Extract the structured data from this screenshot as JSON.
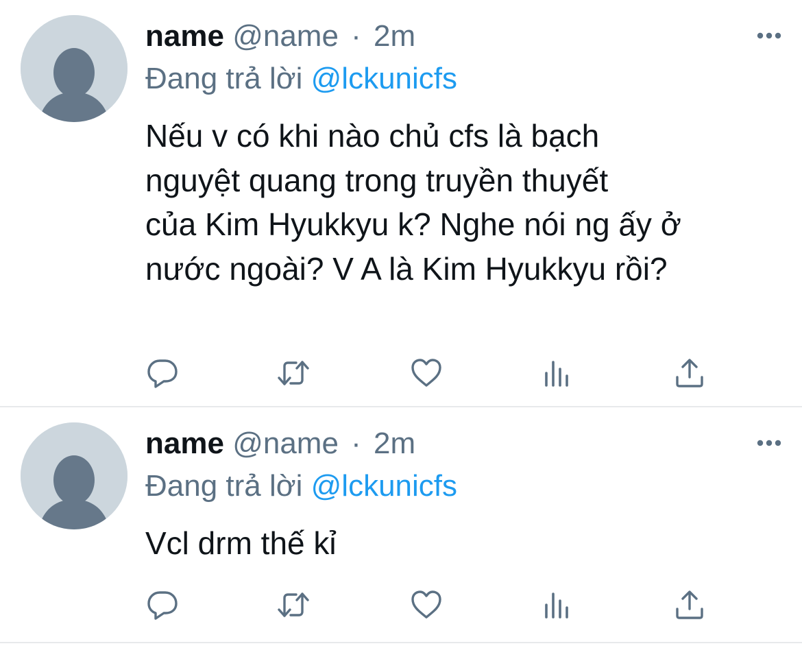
{
  "tweets": [
    {
      "display_name": "name",
      "handle": "@name",
      "separator": "·",
      "time": "2m",
      "reply_prefix": "Đang trả lời",
      "reply_to": "@lckunicfs",
      "text": "Nếu v có khi nào chủ cfs là bạch\nnguyệt quang trong truyền thuyết\ncủa Kim Hyukkyu k? Nghe nói ng ấy ở\nnước ngoài? V A là Kim Hyukkyu rồi?"
    },
    {
      "display_name": "name",
      "handle": "@name",
      "separator": "·",
      "time": "2m",
      "reply_prefix": "Đang trả lời",
      "reply_to": "@lckunicfs",
      "text": "Vcl drm thế kỉ"
    }
  ],
  "icons": {
    "avatar": "default-avatar-icon",
    "more": "more-options-icon",
    "actions": [
      "reply-icon",
      "retweet-icon",
      "like-icon",
      "views-icon",
      "share-icon"
    ]
  },
  "colors": {
    "text": "#0f1419",
    "secondary": "#5b7083",
    "mention": "#1d9bf0",
    "avatar_bg": "#ccd6dd",
    "avatar_fg": "#66788a",
    "divider": "#e7e9eb"
  }
}
